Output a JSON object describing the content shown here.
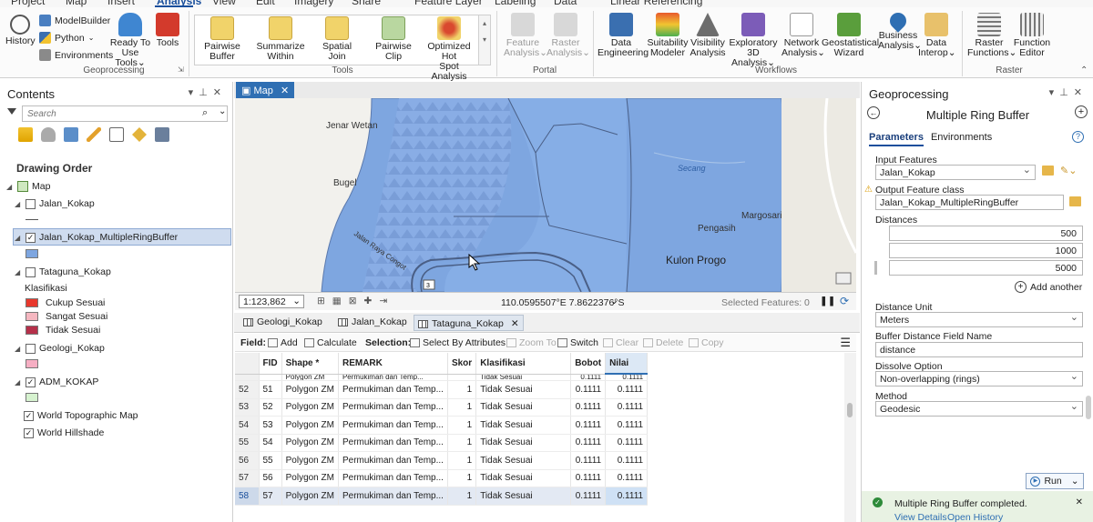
{
  "menubar": {
    "tabs": [
      "Project",
      "Map",
      "Insert",
      "Analysis",
      "View",
      "Edit",
      "Imagery",
      "Share",
      "Feature Layer",
      "Labeling",
      "Data",
      "Linear Referencing"
    ],
    "active": "Analysis"
  },
  "ribbon": {
    "history": "History",
    "modelbuilder": "ModelBuilder",
    "python": "Python",
    "environments": "Environments",
    "ready_to_use_1": "Ready To",
    "ready_to_use_2": "Use Tools",
    "tools": "Tools",
    "group_geoprocessing": "Geoprocessing",
    "gallery": [
      {
        "l1": "Pairwise",
        "l2": "Buffer"
      },
      {
        "l1": "Summarize",
        "l2": "Within"
      },
      {
        "l1": "Spatial",
        "l2": "Join"
      },
      {
        "l1": "Pairwise",
        "l2": "Clip"
      },
      {
        "l1": "Optimized Hot",
        "l2": "Spot Analysis"
      }
    ],
    "group_tools": "Tools",
    "feature_analysis_1": "Feature",
    "feature_analysis_2": "Analysis",
    "raster_analysis_1": "Raster",
    "raster_analysis_2": "Analysis",
    "group_portal": "Portal",
    "workflows": [
      {
        "l1": "Data",
        "l2": "Engineering"
      },
      {
        "l1": "Suitability",
        "l2": "Modeler"
      },
      {
        "l1": "Visibility",
        "l2": "Analysis"
      },
      {
        "l1": "Exploratory",
        "l2": "3D Analysis"
      },
      {
        "l1": "Network",
        "l2": "Analysis"
      },
      {
        "l1": "Geostatistical",
        "l2": "Wizard"
      },
      {
        "l1": "Business",
        "l2": "Analysis"
      },
      {
        "l1": "Data",
        "l2": "Interop"
      }
    ],
    "group_workflows": "Workflows",
    "raster_functions_1": "Raster",
    "raster_functions_2": "Functions",
    "function_editor_1": "Function",
    "function_editor_2": "Editor",
    "group_raster": "Raster"
  },
  "contents": {
    "title": "Contents",
    "search_placeholder": "Search",
    "drawing_order": "Drawing Order",
    "map": "Map",
    "layers": {
      "jalan": "Jalan_Kokap",
      "buffer": "Jalan_Kokap_MultipleRingBuffer",
      "tataguna": "Tataguna_Kokap",
      "klasifikasi": "Klasifikasi",
      "cukup": "Cukup Sesuai",
      "sangat": "Sangat Sesuai",
      "tidak": "Tidak Sesuai",
      "geologi": "Geologi_Kokap",
      "adm": "ADM_KOKAP",
      "topo": "World Topographic Map",
      "hillshade": "World Hillshade"
    }
  },
  "map": {
    "tab": "Map",
    "labels": {
      "jenar": "Jenar Wetan",
      "bugel": "Bugel",
      "secang": "Secang",
      "pengasih": "Pengasih",
      "margosari": "Margosari",
      "kulon": "Kulon Progo",
      "road": "Jalan Raya Congot",
      "shield": "3"
    },
    "scale": "1:123,862",
    "coords": "110.0595507°E 7.8622376°S",
    "selected": "Selected Features: 0"
  },
  "table_tabs": [
    "Geologi_Kokap",
    "Jalan_Kokap",
    "Tataguna_Kokap"
  ],
  "table_toolbar": {
    "field": "Field:",
    "add": "Add",
    "calculate": "Calculate",
    "selection": "Selection:",
    "select_by_attr": "Select By Attributes",
    "zoom_to": "Zoom To",
    "switch": "Switch",
    "clear": "Clear",
    "delete": "Delete",
    "copy": "Copy"
  },
  "table": {
    "columns": [
      "",
      "FID",
      "Shape *",
      "REMARK",
      "Skor",
      "Klasifikasi",
      "Bobot",
      "Nilai"
    ],
    "partial_row": [
      "",
      "",
      "Polygon ZM",
      "Permukiman dan Temp...",
      "",
      "Tidak Sesuai",
      "0.1111",
      "0.1111"
    ],
    "rows": [
      [
        "52",
        "51",
        "Polygon ZM",
        "Permukiman dan Temp...",
        "1",
        "Tidak Sesuai",
        "0.1111",
        "0.1111"
      ],
      [
        "53",
        "52",
        "Polygon ZM",
        "Permukiman dan Temp...",
        "1",
        "Tidak Sesuai",
        "0.1111",
        "0.1111"
      ],
      [
        "54",
        "53",
        "Polygon ZM",
        "Permukiman dan Temp...",
        "1",
        "Tidak Sesuai",
        "0.1111",
        "0.1111"
      ],
      [
        "55",
        "54",
        "Polygon ZM",
        "Permukiman dan Temp...",
        "1",
        "Tidak Sesuai",
        "0.1111",
        "0.1111"
      ],
      [
        "56",
        "55",
        "Polygon ZM",
        "Permukiman dan Temp...",
        "1",
        "Tidak Sesuai",
        "0.1111",
        "0.1111"
      ],
      [
        "57",
        "56",
        "Polygon ZM",
        "Permukiman dan Temp...",
        "1",
        "Tidak Sesuai",
        "0.1111",
        "0.1111"
      ],
      [
        "58",
        "57",
        "Polygon ZM",
        "Permukiman dan Temp...",
        "1",
        "Tidak Sesuai",
        "0.1111",
        "0.1111"
      ]
    ]
  },
  "gp": {
    "panel_title": "Geoprocessing",
    "tool_title": "Multiple Ring Buffer",
    "tab_parameters": "Parameters",
    "tab_environments": "Environments",
    "input_features_label": "Input Features",
    "input_features": "Jalan_Kokap",
    "output_label": "Output Feature class",
    "output": "Jalan_Kokap_MultipleRingBuffer",
    "distances_label": "Distances",
    "distances": [
      "500",
      "1000",
      "5000"
    ],
    "add_another": "Add another",
    "distance_unit_label": "Distance Unit",
    "distance_unit": "Meters",
    "buffer_field_label": "Buffer Distance Field Name",
    "buffer_field": "distance",
    "dissolve_label": "Dissolve Option",
    "dissolve": "Non-overlapping (rings)",
    "method_label": "Method",
    "method": "Geodesic",
    "run": "Run",
    "message": "Multiple Ring Buffer completed.",
    "view_details": "View Details",
    "open_history": "Open History"
  },
  "colors": {
    "accent": "#1a4f9c",
    "buffer_fill": "#7ea6e0",
    "cukup": "#e8382d",
    "sangat": "#f5b7c0",
    "tidak": "#b5304a",
    "geologi": "#f6aec3",
    "adm": "#d6f2cf",
    "success": "#2e8b3a"
  }
}
